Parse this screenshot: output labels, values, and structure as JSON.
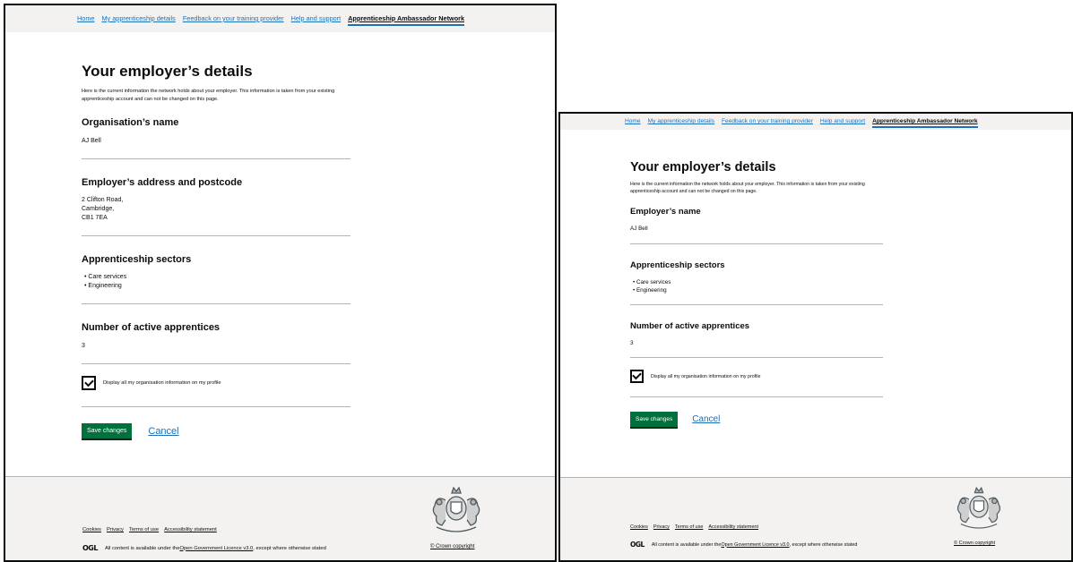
{
  "nav": {
    "items": [
      {
        "label": "Home"
      },
      {
        "label": "My apprenticeship details"
      },
      {
        "label": "Feedback on your training provider"
      },
      {
        "label": "Help and support"
      },
      {
        "label": "Apprenticeship Ambassador Network"
      }
    ]
  },
  "screen1": {
    "title": "Your employer’s details",
    "intro": "Here is the current information the network holds about your employer. This information is taken from your existing apprenticeship account and can not be changed on this page.",
    "org_heading": "Organisation’s name",
    "org_name": "AJ Bell",
    "address_heading": "Employer’s address and postcode",
    "address_lines": [
      "2 Clifton Road,",
      "Cambridge,",
      "CB1 7EA"
    ],
    "sectors_heading": "Apprenticeship sectors",
    "sectors": [
      "Care services",
      "Engineering"
    ],
    "apprentices_heading": "Number of active apprentices",
    "apprentices_count": "3",
    "checkbox_label": "Display all my organisation information on my profile",
    "checkbox_checked": true,
    "save_label": "Save changes",
    "cancel_label": "Cancel"
  },
  "screen2": {
    "title": "Your employer’s details",
    "intro": "Here is the current information the network holds about your employer. This information is taken from your existing apprenticeship account and can not be changed on this page.",
    "employer_heading": "Employer’s name",
    "employer_name": "AJ Bell",
    "sectors_heading": "Apprenticeship sectors",
    "sectors": [
      "Care services",
      "Engineering"
    ],
    "apprentices_heading": "Number of active apprentices",
    "apprentices_count": "3",
    "checkbox_label": "Display all my organisation information on my profile",
    "checkbox_checked": true,
    "save_label": "Save changes",
    "cancel_label": "Cancel"
  },
  "footer": {
    "links": [
      {
        "label": "Cookies"
      },
      {
        "label": "Privacy"
      },
      {
        "label": "Terms of use"
      },
      {
        "label": "Accessibility statement"
      }
    ],
    "ogl_logo": "OGL",
    "licence_prefix": "All content is available under the ",
    "licence_link": "Open Government Licence v3.0",
    "licence_suffix": ", except where otherwise stated",
    "copyright": "© Crown copyright",
    "crest_icon": "royal-coat-of-arms-icon"
  },
  "colors": {
    "link": "#1d70b8",
    "button_green": "#00703c",
    "footer_bg": "#f3f2f1",
    "nav_bg": "#f3f2f1",
    "divider": "#b1b4b6",
    "text": "#0b0c0c"
  }
}
